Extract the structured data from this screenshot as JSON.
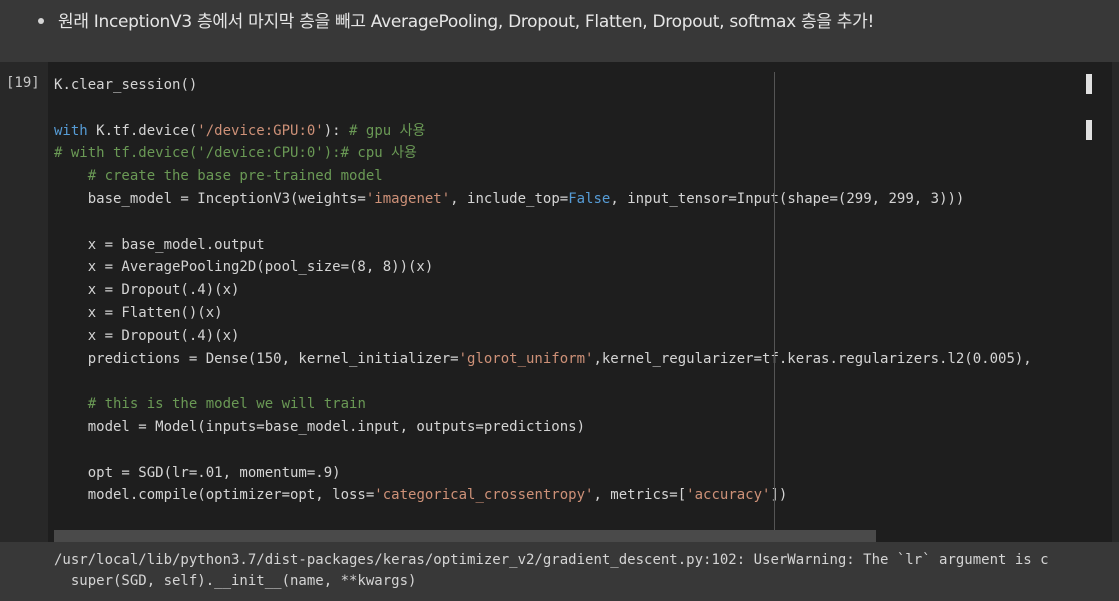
{
  "markdown": {
    "bullet_text": "원래 InceptionV3 층에서 마지막 층을 빼고 AveragePooling, Dropout, Flatten, Dropout, softmax 층을 추가!"
  },
  "cell": {
    "prompt": "[19]",
    "lines": [
      [
        {
          "t": "K",
          "c": "plain"
        },
        {
          "t": ".clear_session()",
          "c": "plain"
        }
      ],
      [],
      [
        {
          "t": "with",
          "c": "kw"
        },
        {
          "t": " K.tf.device(",
          "c": "plain"
        },
        {
          "t": "'/device:GPU:0'",
          "c": "str"
        },
        {
          "t": "): ",
          "c": "plain"
        },
        {
          "t": "# gpu 사용",
          "c": "cmt"
        }
      ],
      [
        {
          "t": "# with tf.device('/device:CPU:0'):# cpu 사용",
          "c": "cmt"
        }
      ],
      [
        {
          "t": "    ",
          "c": "plain"
        },
        {
          "t": "# create the base pre-trained model",
          "c": "cmt"
        }
      ],
      [
        {
          "t": "    base_model = InceptionV3(weights=",
          "c": "plain"
        },
        {
          "t": "'imagenet'",
          "c": "str"
        },
        {
          "t": ", include_top=",
          "c": "plain"
        },
        {
          "t": "False",
          "c": "kw"
        },
        {
          "t": ", input_tensor=Input(shape=(299, 299, 3)))",
          "c": "plain"
        }
      ],
      [],
      [
        {
          "t": "    x = base_model.output",
          "c": "plain"
        }
      ],
      [
        {
          "t": "    x = AveragePooling2D(pool_size=(8, 8))(x)",
          "c": "plain"
        }
      ],
      [
        {
          "t": "    x = Dropout(.4)(x)",
          "c": "plain"
        }
      ],
      [
        {
          "t": "    x = Flatten()(x)",
          "c": "plain"
        }
      ],
      [
        {
          "t": "    x = Dropout(.4)(x)",
          "c": "plain"
        }
      ],
      [
        {
          "t": "    predictions = Dense(150, kernel_initializer=",
          "c": "plain"
        },
        {
          "t": "'glorot_uniform'",
          "c": "str"
        },
        {
          "t": ",kernel_regularizer=tf.keras.regularizers.l2(0.005),",
          "c": "plain"
        }
      ],
      [],
      [
        {
          "t": "    ",
          "c": "plain"
        },
        {
          "t": "# this is the model we will train",
          "c": "cmt"
        }
      ],
      [
        {
          "t": "    model = Model(inputs=base_model.input, outputs=predictions)",
          "c": "plain"
        }
      ],
      [],
      [
        {
          "t": "    opt = SGD(lr=.01, momentum=.9)",
          "c": "plain"
        }
      ],
      [
        {
          "t": "    model.compile(optimizer=opt, loss=",
          "c": "plain"
        },
        {
          "t": "'categorical_crossentropy'",
          "c": "str"
        },
        {
          "t": ", metrics=[",
          "c": "plain"
        },
        {
          "t": "'accuracy'",
          "c": "str"
        },
        {
          "t": "])",
          "c": "plain"
        }
      ]
    ]
  },
  "output": {
    "line1": "/usr/local/lib/python3.7/dist-packages/keras/optimizer_v2/gradient_descent.py:102: UserWarning: The `lr` argument is c",
    "line2": "  super(SGD, self).__init__(name, **kwargs)"
  }
}
